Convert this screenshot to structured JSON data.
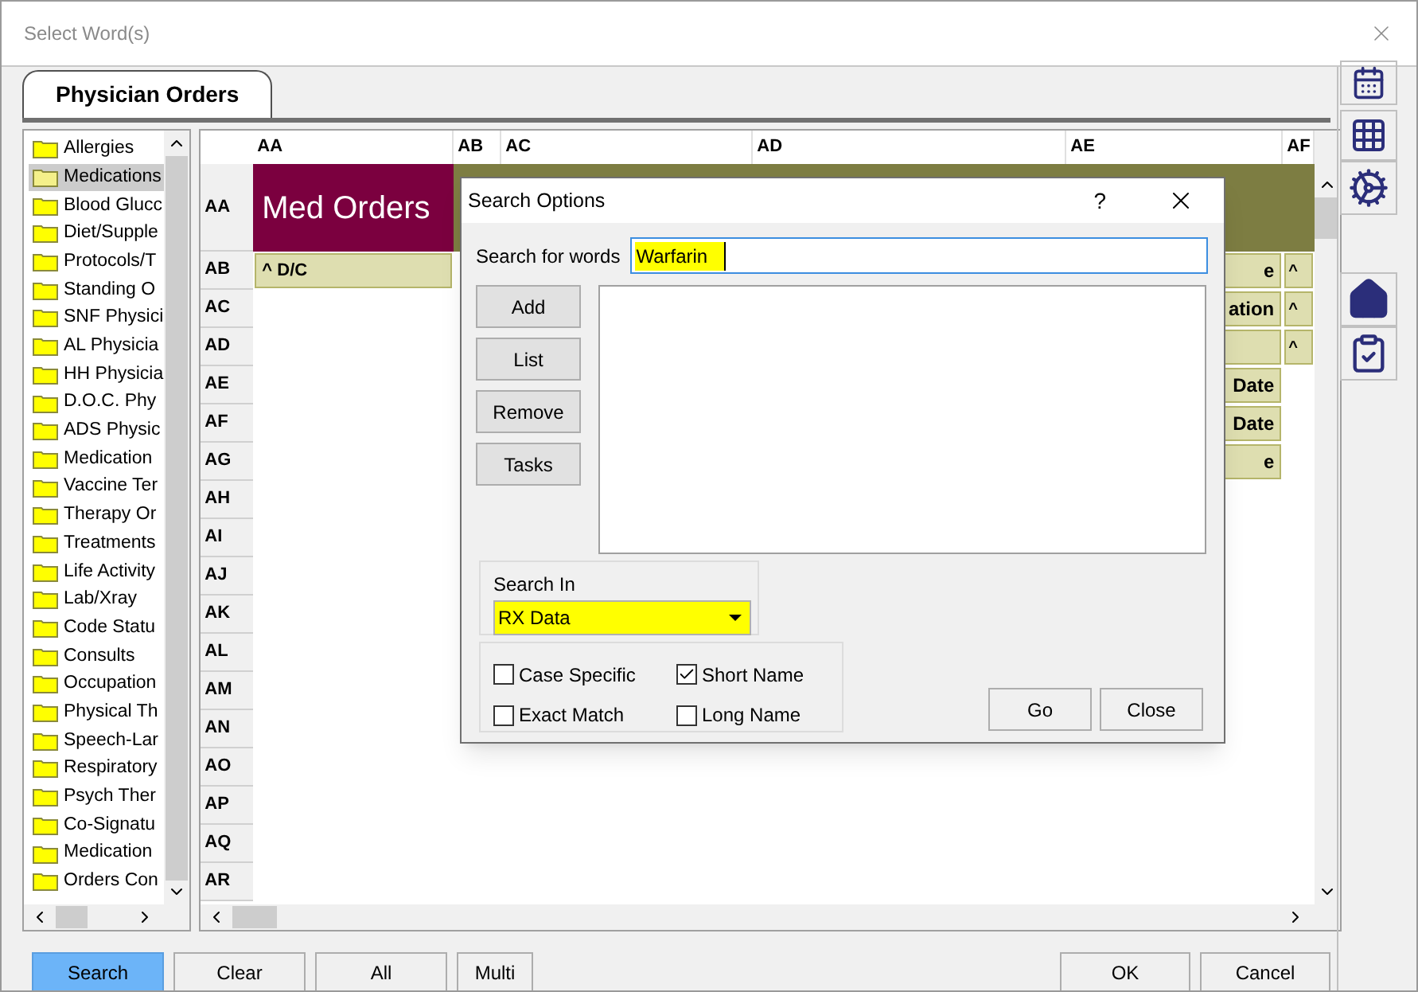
{
  "window": {
    "title": "Select Word(s)"
  },
  "tabs": [
    {
      "label": "Physician Orders",
      "selected": true
    }
  ],
  "tree": {
    "items": [
      {
        "label": "Allergies",
        "selected": false
      },
      {
        "label": "Medications",
        "selected": true
      },
      {
        "label": "Blood Glucc",
        "selected": false
      },
      {
        "label": "Diet/Supple",
        "selected": false
      },
      {
        "label": "Protocols/T",
        "selected": false
      },
      {
        "label": "Standing O",
        "selected": false
      },
      {
        "label": "SNF Physici",
        "selected": false
      },
      {
        "label": "AL Physicia",
        "selected": false
      },
      {
        "label": "HH Physicia",
        "selected": false
      },
      {
        "label": "D.O.C. Phy",
        "selected": false
      },
      {
        "label": "ADS Physic",
        "selected": false
      },
      {
        "label": "Medication",
        "selected": false
      },
      {
        "label": "Vaccine Ter",
        "selected": false
      },
      {
        "label": "Therapy Or",
        "selected": false
      },
      {
        "label": "Treatments",
        "selected": false
      },
      {
        "label": "Life Activity",
        "selected": false
      },
      {
        "label": "Lab/Xray",
        "selected": false
      },
      {
        "label": "Code Statu",
        "selected": false
      },
      {
        "label": "Consults",
        "selected": false
      },
      {
        "label": "Occupation",
        "selected": false
      },
      {
        "label": "Physical Th",
        "selected": false
      },
      {
        "label": "Speech-Lar",
        "selected": false
      },
      {
        "label": "Respiratory",
        "selected": false
      },
      {
        "label": "Psych Ther",
        "selected": false
      },
      {
        "label": "Co-Signatu",
        "selected": false
      },
      {
        "label": "Medication",
        "selected": false
      },
      {
        "label": "Orders Con",
        "selected": false
      }
    ]
  },
  "grid": {
    "columns": [
      "AA",
      "AB",
      "AC",
      "AD",
      "AE",
      "AF"
    ],
    "rows": [
      {
        "label": "AA",
        "kind": "title",
        "text": "Med Orders"
      },
      {
        "label": "AB",
        "kind": "item",
        "col_aa": "^ D/C",
        "col_ae": "e",
        "col_af": "^"
      },
      {
        "label": "AC",
        "kind": "item",
        "col_ae": "ation",
        "col_af": "^"
      },
      {
        "label": "AD",
        "kind": "item",
        "col_ae": "",
        "col_af": "^"
      },
      {
        "label": "AE",
        "kind": "item",
        "col_ae": "Date"
      },
      {
        "label": "AF",
        "kind": "item",
        "col_ae": "Date"
      },
      {
        "label": "AG",
        "kind": "item",
        "col_ae": "e"
      },
      {
        "label": "AH",
        "kind": "item"
      },
      {
        "label": "AI",
        "kind": "item"
      },
      {
        "label": "AJ",
        "kind": "item"
      },
      {
        "label": "AK",
        "kind": "item"
      },
      {
        "label": "AL",
        "kind": "item"
      },
      {
        "label": "AM",
        "kind": "item"
      },
      {
        "label": "AN",
        "kind": "item"
      },
      {
        "label": "AO",
        "kind": "item"
      },
      {
        "label": "AP",
        "kind": "item"
      },
      {
        "label": "AQ",
        "kind": "item"
      },
      {
        "label": "AR",
        "kind": "item"
      }
    ]
  },
  "dialog": {
    "title": "Search Options",
    "help": "?",
    "search_label": "Search for words",
    "search_value": "Warfarin",
    "side_buttons": [
      "Add",
      "List",
      "Remove",
      "Tasks"
    ],
    "search_in": {
      "label": "Search In",
      "value": "RX Data"
    },
    "options": [
      {
        "label": "Case Specific",
        "checked": false
      },
      {
        "label": "Short Name",
        "checked": true
      },
      {
        "label": "Exact Match",
        "checked": false
      },
      {
        "label": "Long Name",
        "checked": false
      }
    ],
    "buttons": [
      "Go",
      "Close"
    ]
  },
  "bottom_buttons": [
    {
      "label": "Search",
      "selected": true
    },
    {
      "label": "Clear",
      "selected": false
    },
    {
      "label": "All",
      "selected": false
    },
    {
      "label": "Multi",
      "selected": false
    }
  ],
  "dialog_buttons": [
    "OK",
    "Cancel"
  ]
}
